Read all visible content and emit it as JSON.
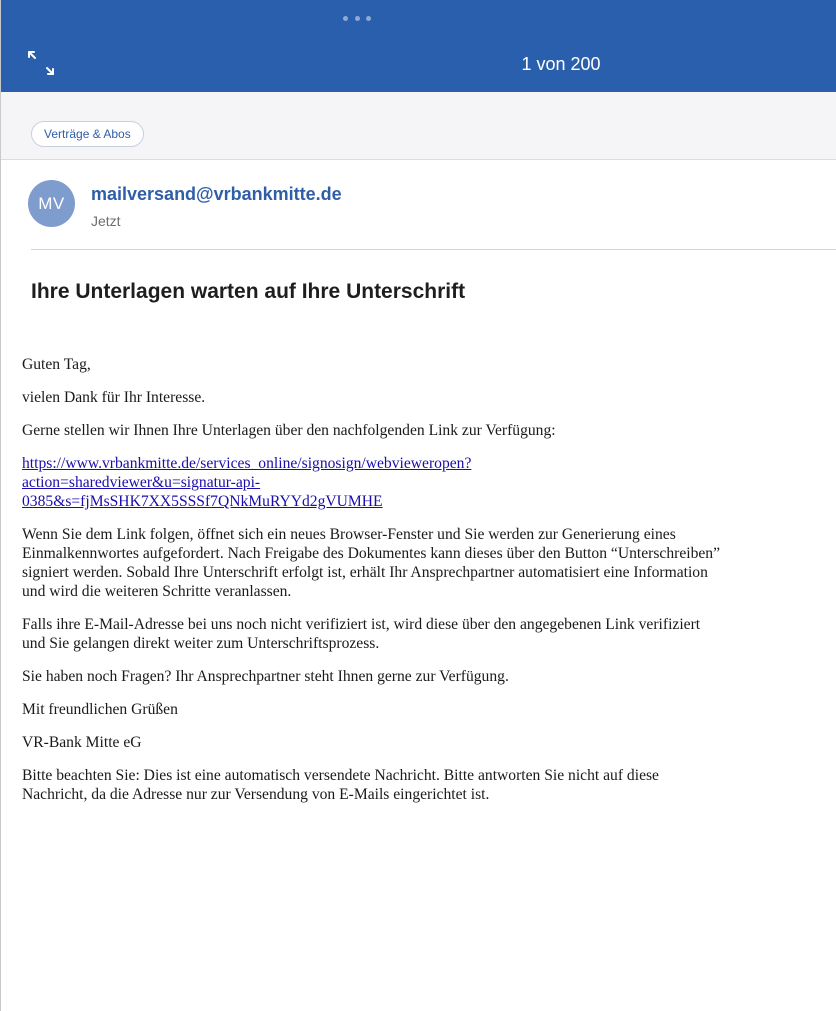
{
  "header": {
    "counter": "1 von 200",
    "expand_icon": "expand-arrows-icon",
    "grabber_icon": "drag-handle-dots"
  },
  "category": {
    "label": "Verträge & Abos"
  },
  "sender": {
    "initials": "MV",
    "address": "mailversand@vrbankmitte.de",
    "time": "Jetzt"
  },
  "subject": "Ihre Unterlagen warten auf Ihre Unterschrift",
  "body": {
    "greeting": "Guten Tag,",
    "thanks": "vielen Dank für Ihr Interesse.",
    "intro": "Gerne stellen wir Ihnen Ihre Unterlagen über den nachfolgenden Link zur Verfügung:",
    "link_line1": "https://www.vrbankmitte.de/services_online/signosign/webvieweropen?",
    "link_line2": "action=sharedviewer&u=signatur-api-",
    "link_line3": "0385&s=fjMsSHK7XX5SSSf7QNkMuRYYd2gVUMHE",
    "instructions": "Wenn Sie dem Link folgen, öffnet sich ein neues Browser-Fenster und Sie werden zur Generierung eines Einmalkennwortes aufgefordert. Nach Freigabe des Dokumentes kann dieses über den Button “Unterschreiben” signiert werden. Sobald Ihre Unterschrift erfolgt ist, erhält Ihr Ansprechpartner automatisiert eine Information und wird die weiteren Schritte veranlassen.",
    "verification": "Falls ihre E-Mail-Adresse bei uns noch nicht verifiziert ist, wird diese über den angegebenen Link verifiziert und Sie gelangen direkt weiter zum Unterschriftsprozess.",
    "questions": "Sie haben noch Fragen? Ihr Ansprechpartner steht Ihnen gerne zur Verfügung.",
    "closing": "Mit freundlichen Grüßen",
    "signature": "VR-Bank Mitte eG",
    "disclaimer": "Bitte beachten Sie: Dies ist eine automatisch versendete Nachricht. Bitte antworten Sie nicht auf diese Nachricht, da die Adresse nur zur Versendung von E-Mails eingerichtet ist."
  },
  "colors": {
    "header_bg": "#2a5fae",
    "accent": "#2f5ea8",
    "avatar_bg": "#7f9ccf",
    "link": "#1a0dab"
  }
}
